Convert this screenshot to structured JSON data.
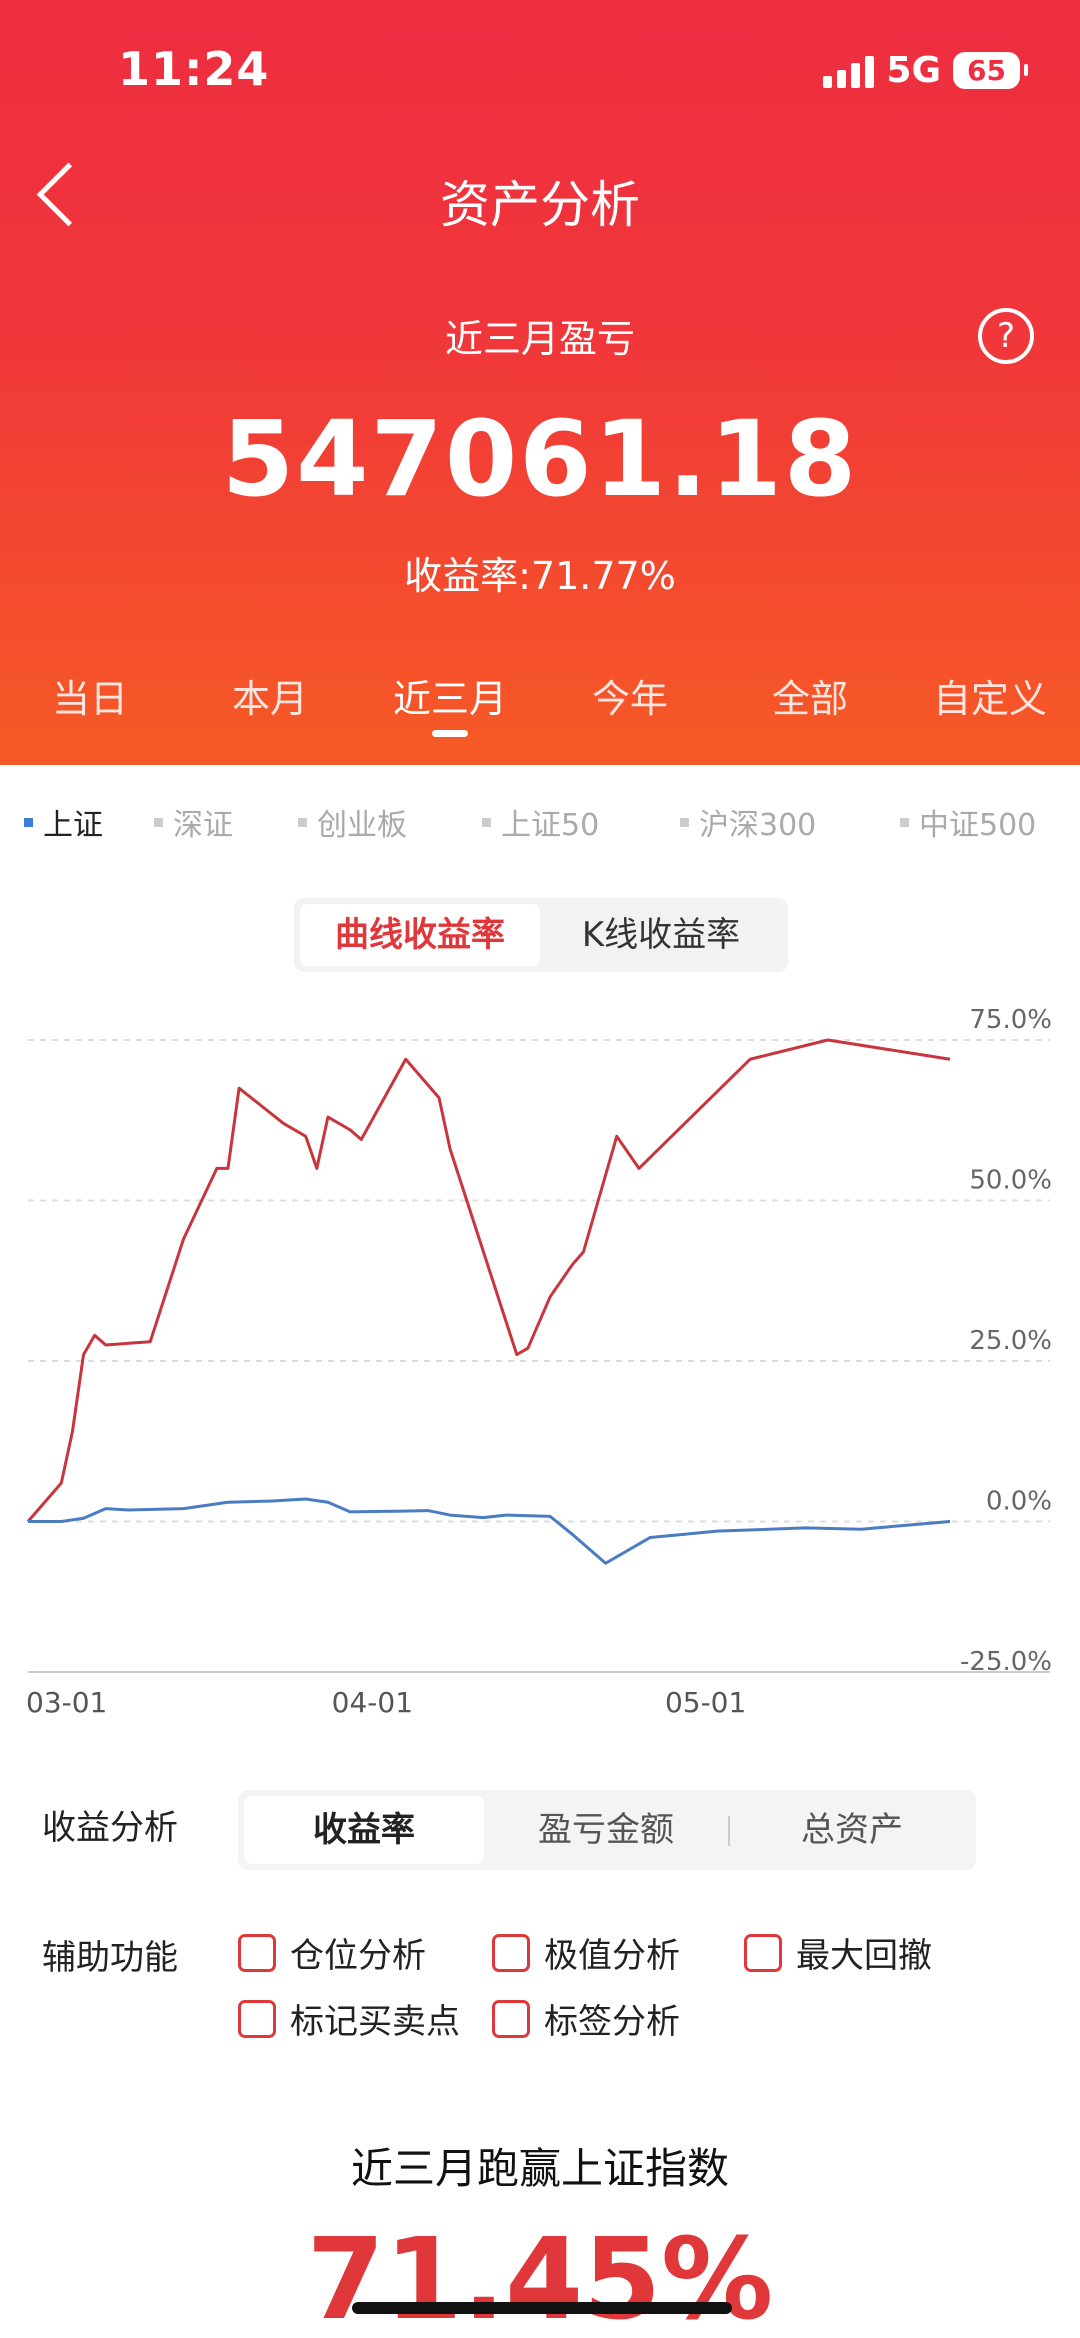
{
  "status": {
    "time": "11:24",
    "network": "5G",
    "battery": "65"
  },
  "header": {
    "title": "资产分析",
    "subtitle": "近三月盈亏",
    "amount": "547061.18",
    "rate_text": "收益率:71.77%",
    "help": "?"
  },
  "periods": [
    "当日",
    "本月",
    "近三月",
    "今年",
    "全部",
    "自定义"
  ],
  "active_period": "近三月",
  "index_tabs": [
    "上证",
    "深证",
    "创业板",
    "上证50",
    "沪深300",
    "中证500"
  ],
  "active_index": "上证",
  "mode_toggle": {
    "curve": "曲线收益率",
    "kline": "K线收益率"
  },
  "chart_data": {
    "type": "line",
    "x_ticks": [
      "03-01",
      "04-01",
      "05-01"
    ],
    "y_ticks": [
      "75.0%",
      "50.0%",
      "25.0%",
      "0.0%",
      "-25.0%"
    ],
    "ylim": [
      -25,
      75
    ],
    "x_range_days": [
      0,
      92
    ],
    "series": [
      {
        "color": "#c9353d",
        "points": [
          [
            0,
            0
          ],
          [
            3,
            6
          ],
          [
            4,
            14
          ],
          [
            5,
            26
          ],
          [
            6,
            29
          ],
          [
            7,
            27.5
          ],
          [
            11,
            28
          ],
          [
            14,
            44
          ],
          [
            17,
            55
          ],
          [
            18,
            55
          ],
          [
            19,
            67.5
          ],
          [
            23,
            62
          ],
          [
            25,
            60
          ],
          [
            26,
            55
          ],
          [
            27,
            63
          ],
          [
            29,
            61
          ],
          [
            30,
            59.5
          ],
          [
            34,
            72
          ],
          [
            36,
            68
          ],
          [
            37,
            66
          ],
          [
            38,
            58
          ],
          [
            44,
            26
          ],
          [
            45,
            27
          ],
          [
            47,
            35
          ],
          [
            49,
            40
          ],
          [
            50,
            42
          ],
          [
            53,
            60
          ],
          [
            55,
            55
          ],
          [
            65,
            72
          ],
          [
            72,
            75
          ],
          [
            83,
            72
          ]
        ]
      },
      {
        "color": "#4a7cc2",
        "points": [
          [
            0,
            0
          ],
          [
            3,
            0
          ],
          [
            5,
            0.5
          ],
          [
            7,
            2
          ],
          [
            9,
            1.8
          ],
          [
            14,
            2
          ],
          [
            18,
            3
          ],
          [
            22,
            3.2
          ],
          [
            25,
            3.5
          ],
          [
            27,
            3
          ],
          [
            29,
            1.5
          ],
          [
            33,
            1.6
          ],
          [
            36,
            1.7
          ],
          [
            38,
            1
          ],
          [
            41,
            0.6
          ],
          [
            43,
            1
          ],
          [
            47,
            0.8
          ],
          [
            49,
            -2
          ],
          [
            52,
            -6.5
          ],
          [
            56,
            -2.5
          ],
          [
            59,
            -2
          ],
          [
            62,
            -1.5
          ],
          [
            70,
            -1
          ],
          [
            75,
            -1.2
          ],
          [
            83,
            0
          ]
        ]
      }
    ]
  },
  "analysis": {
    "label": "收益分析",
    "tabs": [
      "收益率",
      "盈亏金额",
      "总资产"
    ],
    "active": "收益率"
  },
  "aux": {
    "label": "辅助功能",
    "options": [
      "仓位分析",
      "极值分析",
      "最大回撤",
      "标记买卖点",
      "标签分析"
    ]
  },
  "beat": {
    "title": "近三月跑赢上证指数",
    "value": "71.45%"
  }
}
